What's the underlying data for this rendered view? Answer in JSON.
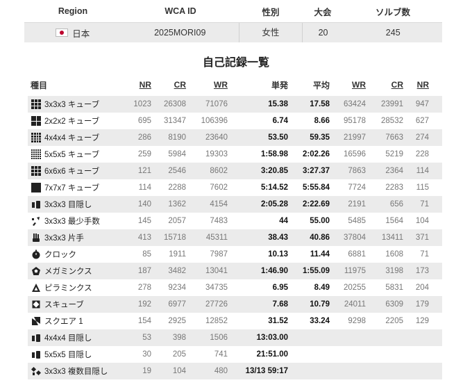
{
  "profile": {
    "headers": {
      "region": "Region",
      "wca_id": "WCA ID",
      "gender": "性別",
      "competitions": "大会",
      "solves": "ソルブ数"
    },
    "row": {
      "region": "日本",
      "wca_id": "2025MORI09",
      "gender": "女性",
      "competitions": "20",
      "solves": "245"
    }
  },
  "section_title": "自己記録一覧",
  "records": {
    "headers": {
      "event": "種目",
      "single_nr": "NR",
      "single_cr": "CR",
      "single_wr": "WR",
      "single": "単発",
      "average": "平均",
      "avg_wr": "WR",
      "avg_cr": "CR",
      "avg_nr": "NR"
    },
    "rows": [
      {
        "icon": "cube-3x3-icon",
        "event": "3x3x3 キューブ",
        "snr": "1023",
        "scr": "26308",
        "swr": "71076",
        "single": "15.38",
        "average": "17.58",
        "awr": "63424",
        "acr": "23991",
        "anr": "947"
      },
      {
        "icon": "cube-2x2-icon",
        "event": "2x2x2 キューブ",
        "snr": "695",
        "scr": "31347",
        "swr": "106396",
        "single": "6.74",
        "average": "8.66",
        "awr": "95178",
        "acr": "28532",
        "anr": "627"
      },
      {
        "icon": "cube-4x4-icon",
        "event": "4x4x4 キューブ",
        "snr": "286",
        "scr": "8190",
        "swr": "23640",
        "single": "53.50",
        "average": "59.35",
        "awr": "21997",
        "acr": "7663",
        "anr": "274"
      },
      {
        "icon": "cube-5x5-icon",
        "event": "5x5x5 キューブ",
        "snr": "259",
        "scr": "5984",
        "swr": "19303",
        "single": "1:58.98",
        "average": "2:02.26",
        "awr": "16596",
        "acr": "5219",
        "anr": "228"
      },
      {
        "icon": "cube-6x6-icon",
        "event": "6x6x6 キューブ",
        "snr": "121",
        "scr": "2546",
        "swr": "8602",
        "single": "3:20.85",
        "average": "3:27.37",
        "awr": "7863",
        "acr": "2364",
        "anr": "114"
      },
      {
        "icon": "cube-7x7-icon",
        "event": "7x7x7 キューブ",
        "snr": "114",
        "scr": "2288",
        "swr": "7602",
        "single": "5:14.52",
        "average": "5:55.84",
        "awr": "7724",
        "acr": "2283",
        "anr": "115"
      },
      {
        "icon": "blindfolded-icon",
        "event": "3x3x3 目隠し",
        "snr": "140",
        "scr": "1362",
        "swr": "4154",
        "single": "2:05.28",
        "average": "2:22.69",
        "awr": "2191",
        "acr": "656",
        "anr": "71"
      },
      {
        "icon": "fewest-moves-icon",
        "event": "3x3x3 最少手数",
        "snr": "145",
        "scr": "2057",
        "swr": "7483",
        "single": "44",
        "average": "55.00",
        "awr": "5485",
        "acr": "1564",
        "anr": "104"
      },
      {
        "icon": "one-handed-icon",
        "event": "3x3x3 片手",
        "snr": "413",
        "scr": "15718",
        "swr": "45311",
        "single": "38.43",
        "average": "40.86",
        "awr": "37804",
        "acr": "13411",
        "anr": "371"
      },
      {
        "icon": "clock-icon",
        "event": "クロック",
        "snr": "85",
        "scr": "1911",
        "swr": "7987",
        "single": "10.13",
        "average": "11.44",
        "awr": "6881",
        "acr": "1608",
        "anr": "71"
      },
      {
        "icon": "megaminx-icon",
        "event": "メガミンクス",
        "snr": "187",
        "scr": "3482",
        "swr": "13041",
        "single": "1:46.90",
        "average": "1:55.09",
        "awr": "11975",
        "acr": "3198",
        "anr": "173"
      },
      {
        "icon": "pyraminx-icon",
        "event": "ピラミンクス",
        "snr": "278",
        "scr": "9234",
        "swr": "34735",
        "single": "6.95",
        "average": "8.49",
        "awr": "20255",
        "acr": "5831",
        "anr": "204"
      },
      {
        "icon": "skewb-icon",
        "event": "スキューブ",
        "snr": "192",
        "scr": "6977",
        "swr": "27726",
        "single": "7.68",
        "average": "10.79",
        "awr": "24011",
        "acr": "6309",
        "anr": "179"
      },
      {
        "icon": "square-1-icon",
        "event": "スクエア 1",
        "snr": "154",
        "scr": "2925",
        "swr": "12852",
        "single": "31.52",
        "average": "33.24",
        "awr": "9298",
        "acr": "2205",
        "anr": "129"
      },
      {
        "icon": "blindfolded-4x4-icon",
        "event": "4x4x4 目隠し",
        "snr": "53",
        "scr": "398",
        "swr": "1506",
        "single": "13:03.00",
        "average": "",
        "awr": "",
        "acr": "",
        "anr": ""
      },
      {
        "icon": "blindfolded-5x5-icon",
        "event": "5x5x5 目隠し",
        "snr": "30",
        "scr": "205",
        "swr": "741",
        "single": "21:51.00",
        "average": "",
        "awr": "",
        "acr": "",
        "anr": ""
      },
      {
        "icon": "multi-blind-icon",
        "event": "3x3x3 複数目隠し",
        "snr": "19",
        "scr": "104",
        "swr": "480",
        "single": "13/13 59:17",
        "average": "",
        "awr": "",
        "acr": "",
        "anr": ""
      }
    ]
  }
}
